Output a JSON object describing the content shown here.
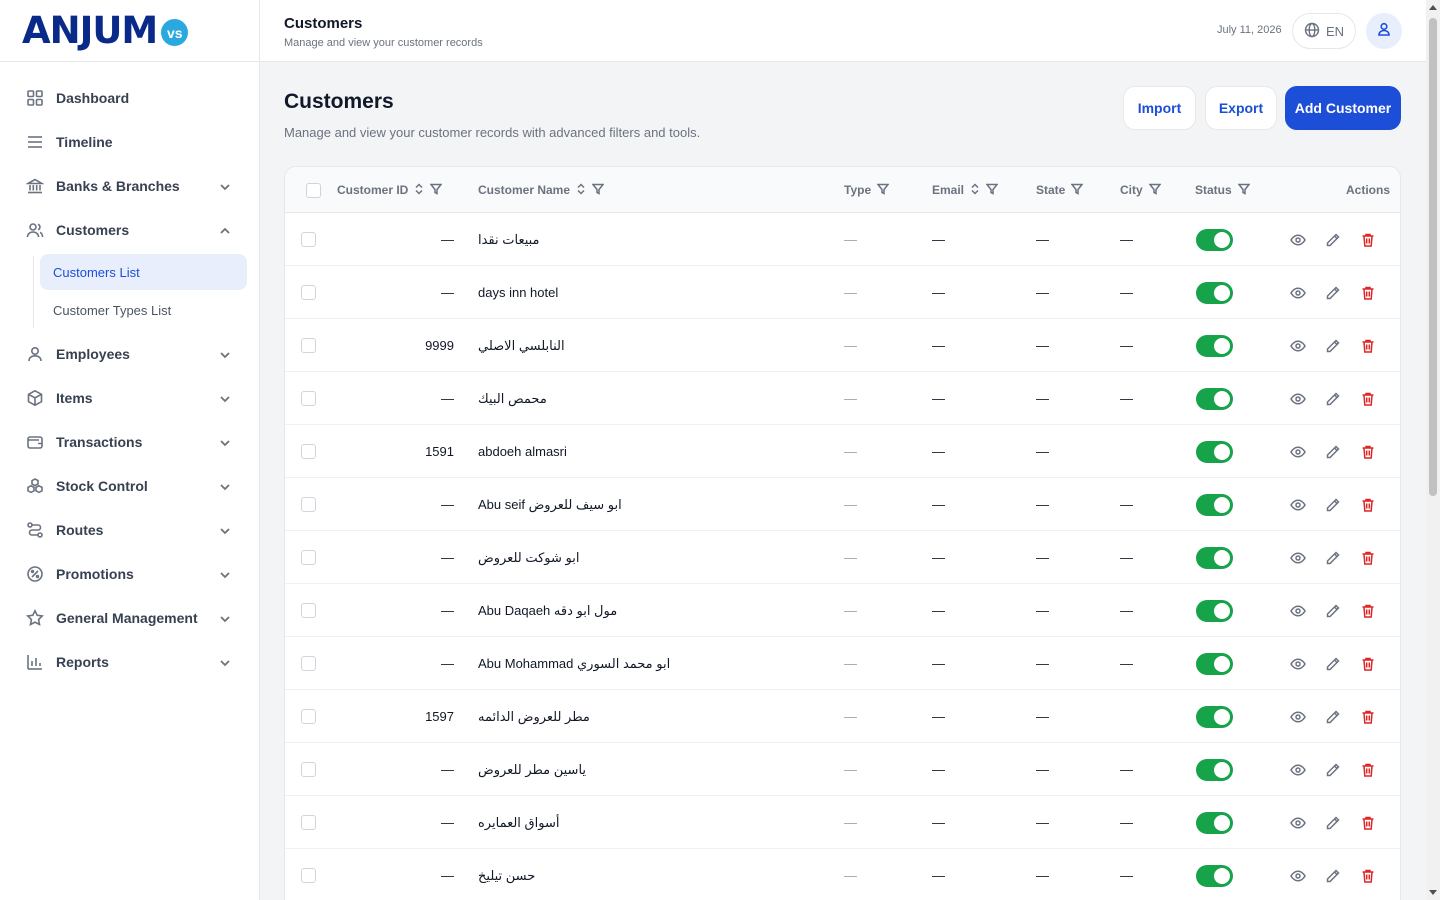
{
  "brand": {
    "logo_text": "ANJUM",
    "logo_badge": "vs"
  },
  "sidebar": {
    "items": [
      {
        "label": "Dashboard",
        "icon": "dashboard-grid-icon",
        "expandable": false
      },
      {
        "label": "Timeline",
        "icon": "list-lines-icon",
        "expandable": false
      },
      {
        "label": "Banks & Branches",
        "icon": "bank-icon",
        "expandable": true
      },
      {
        "label": "Customers",
        "icon": "users-icon",
        "expandable": true,
        "expanded": true
      },
      {
        "label": "Employees",
        "icon": "user-icon",
        "expandable": true
      },
      {
        "label": "Items",
        "icon": "box-icon",
        "expandable": true
      },
      {
        "label": "Transactions",
        "icon": "wallet-icon",
        "expandable": true
      },
      {
        "label": "Stock Control",
        "icon": "boxes-icon",
        "expandable": true
      },
      {
        "label": "Routes",
        "icon": "route-icon",
        "expandable": true
      },
      {
        "label": "Promotions",
        "icon": "percent-badge-icon",
        "expandable": true
      },
      {
        "label": "General Management",
        "icon": "star-icon",
        "expandable": true
      },
      {
        "label": "Reports",
        "icon": "bar-chart-icon",
        "expandable": true
      }
    ],
    "customers_sub": [
      {
        "label": "Customers List",
        "active": true
      },
      {
        "label": "Customer Types List",
        "active": false
      }
    ]
  },
  "header": {
    "title": "Customers",
    "subtitle": "Manage and view your customer records",
    "date": "July 11, 2026",
    "lang": "EN"
  },
  "main": {
    "title": "Customers",
    "subtitle": "Manage and view your customer records with advanced filters and tools.",
    "buttons": {
      "import": "Import",
      "export": "Export",
      "add": "Add Customer"
    }
  },
  "table": {
    "columns": {
      "customer_id": "Customer ID",
      "customer_name": "Customer Name",
      "type": "Type",
      "email": "Email",
      "state": "State",
      "city": "City",
      "status": "Status",
      "actions": "Actions"
    },
    "rows": [
      {
        "id": "—",
        "name": "مبيعات نقدا",
        "type": "—",
        "email": "—",
        "state": "—",
        "city": "—",
        "active": true
      },
      {
        "id": "—",
        "name": "days inn hotel",
        "type": "—",
        "email": "—",
        "state": "—",
        "city": "—",
        "active": true
      },
      {
        "id": "9999",
        "name": "النابلسي الاصلي",
        "type": "—",
        "email": "—",
        "state": "—",
        "city": "—",
        "active": true
      },
      {
        "id": "—",
        "name": "محمص البيك",
        "type": "—",
        "email": "—",
        "state": "—",
        "city": "—",
        "active": true
      },
      {
        "id": "1591",
        "name": "abdoeh almasri",
        "type": "—",
        "email": "—",
        "state": "—",
        "city": "",
        "active": true
      },
      {
        "id": "—",
        "name": "Abu seif ابو سيف للعروض",
        "type": "—",
        "email": "—",
        "state": "—",
        "city": "—",
        "active": true
      },
      {
        "id": "—",
        "name": "ابو شوكت للعروض",
        "type": "—",
        "email": "—",
        "state": "—",
        "city": "—",
        "active": true
      },
      {
        "id": "—",
        "name": "Abu Daqaeh مول ابو دقه",
        "type": "—",
        "email": "—",
        "state": "—",
        "city": "—",
        "active": true
      },
      {
        "id": "—",
        "name": "Abu Mohammad ابو محمد السوري",
        "type": "—",
        "email": "—",
        "state": "—",
        "city": "—",
        "active": true
      },
      {
        "id": "1597",
        "name": "مطر للعروض الدائمه",
        "type": "—",
        "email": "—",
        "state": "—",
        "city": "",
        "active": true
      },
      {
        "id": "—",
        "name": "ياسين مطر للعروض",
        "type": "—",
        "email": "—",
        "state": "—",
        "city": "—",
        "active": true
      },
      {
        "id": "—",
        "name": "أسواق العمايره",
        "type": "—",
        "email": "—",
        "state": "—",
        "city": "—",
        "active": true
      },
      {
        "id": "—",
        "name": "حسن تيليخ",
        "type": "—",
        "email": "—",
        "state": "—",
        "city": "—",
        "active": true
      }
    ]
  },
  "colors": {
    "brand": "#0a2a8a",
    "accent": "#1d4ed8",
    "active_toggle": "#16a34a",
    "danger": "#dc2626"
  }
}
